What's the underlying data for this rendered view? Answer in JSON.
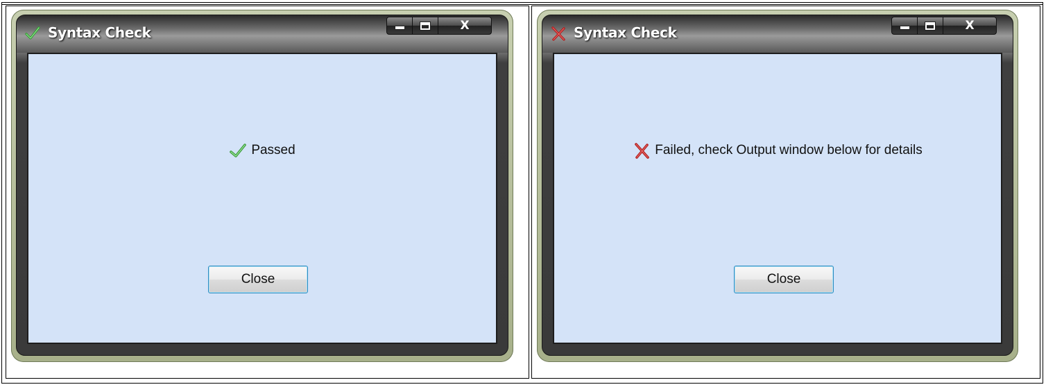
{
  "dialogs": [
    {
      "title": "Syntax Check",
      "status": "passed",
      "title_icon": "check-icon",
      "message": "Passed",
      "message_icon": "check-icon",
      "close_label": "Close",
      "controls": {
        "minimize": "minimize-icon",
        "maximize": "maximize-icon",
        "close": "X"
      }
    },
    {
      "title": "Syntax Check",
      "status": "failed",
      "title_icon": "cross-icon",
      "message": "Failed, check Output window below for details",
      "message_icon": "cross-icon",
      "close_label": "Close",
      "controls": {
        "minimize": "minimize-icon",
        "maximize": "maximize-icon",
        "close": "X"
      }
    }
  ],
  "colors": {
    "client_bg": "#d4e3f8",
    "check_green": "#4caf50",
    "cross_red": "#c62828",
    "button_border": "#2d8bbf",
    "window_frame": "#a7b08a"
  }
}
